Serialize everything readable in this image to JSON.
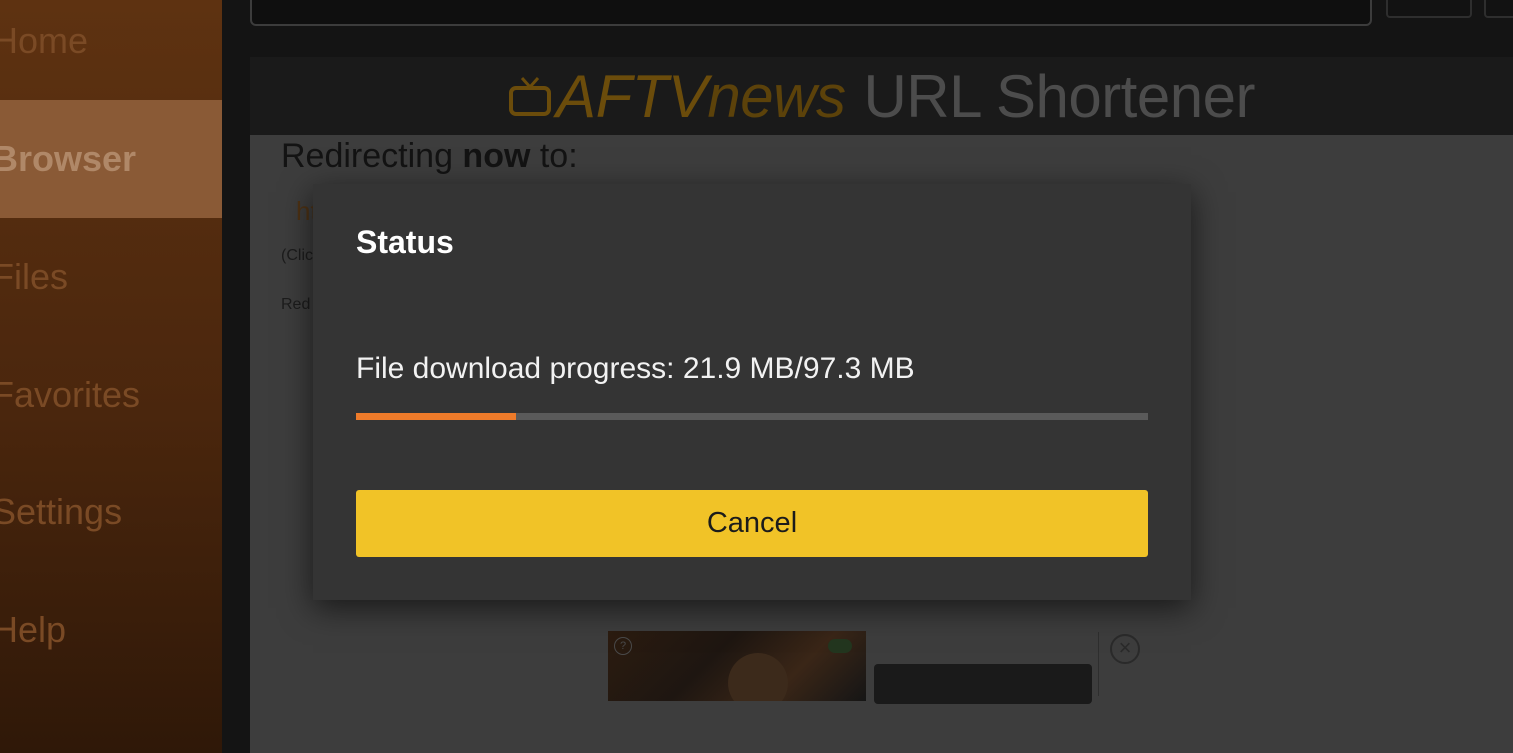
{
  "sidebar": {
    "items": [
      {
        "label": "Home"
      },
      {
        "label": "Browser"
      },
      {
        "label": "Files"
      },
      {
        "label": "Favorites"
      },
      {
        "label": "Settings"
      },
      {
        "label": "Help"
      }
    ],
    "active_item": "Browser",
    "accent_color": "#5e3211"
  },
  "webpage": {
    "banner": {
      "brand_main": "AFTV",
      "brand_news": "news",
      "title": "URL Shortener"
    },
    "redirect_prefix": "Redirecting ",
    "redirect_bold": "now",
    "redirect_suffix": " to:",
    "link_fragment": "ht",
    "note_fragment": "(Clic",
    "note_fragment2": "Red"
  },
  "dialog": {
    "title": "Status",
    "progress_text": "File download progress: 21.9 MB/97.3 MB",
    "downloaded_mb": 21.9,
    "total_mb": 97.3,
    "progress_fraction": 0.2015,
    "cancel_label": "Cancel",
    "progress_color": "#ee7b2a",
    "button_color": "#f1c327"
  }
}
